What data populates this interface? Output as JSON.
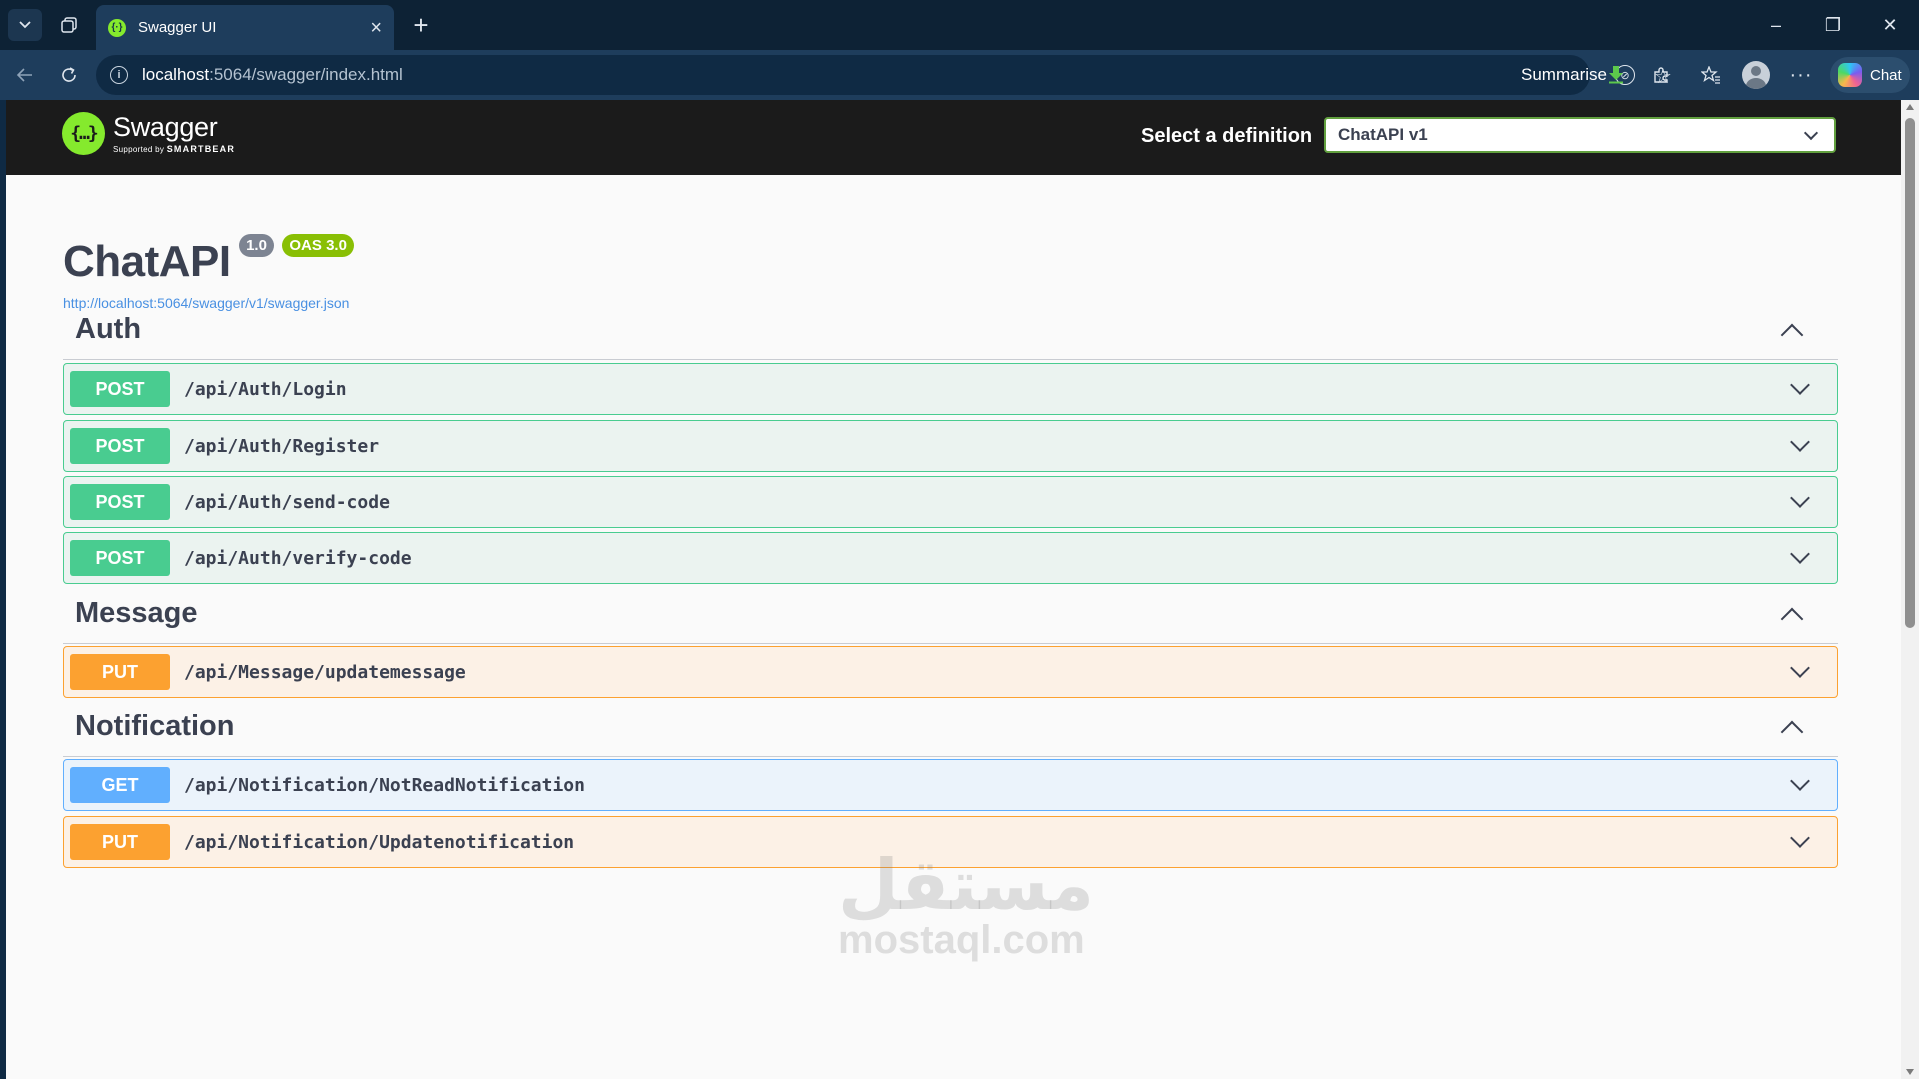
{
  "browser": {
    "tab": {
      "title": "Swagger UI",
      "favicon_glyph": "{·}"
    },
    "url": {
      "host": "localhost",
      "rest": ":5064/swagger/index.html"
    },
    "summarise_label": "Summarise",
    "chat_label": "Chat",
    "window_controls": {
      "minimize": "–",
      "restore": "❐",
      "close": "✕"
    }
  },
  "topbar": {
    "logo_name": "Swagger",
    "logo_supported": "Supported by",
    "logo_brand": "SMARTBEAR",
    "definition_label": "Select a definition",
    "definition_value": "ChatAPI v1"
  },
  "info": {
    "title": "ChatAPI",
    "version": "1.0",
    "oas": "OAS 3.0",
    "spec_url": "http://localhost:5064/swagger/v1/swagger.json"
  },
  "sections": [
    {
      "name": "Auth",
      "operations": [
        {
          "method": "POST",
          "path": "/api/Auth/Login"
        },
        {
          "method": "POST",
          "path": "/api/Auth/Register"
        },
        {
          "method": "POST",
          "path": "/api/Auth/send-code"
        },
        {
          "method": "POST",
          "path": "/api/Auth/verify-code"
        }
      ]
    },
    {
      "name": "Message",
      "operations": [
        {
          "method": "PUT",
          "path": "/api/Message/updatemessage"
        }
      ]
    },
    {
      "name": "Notification",
      "operations": [
        {
          "method": "GET",
          "path": "/api/Notification/NotReadNotification"
        },
        {
          "method": "PUT",
          "path": "/api/Notification/Updatenotification"
        }
      ]
    }
  ],
  "watermark": {
    "arabic": "مستقل",
    "latin": "mostaql.com"
  },
  "colors": {
    "post": "#49cc90",
    "put": "#fca130",
    "get": "#61affe",
    "swagger_green": "#85ea2d"
  },
  "icons": {
    "expand": "chevron-down-icon",
    "collapse": "chevron-up-icon"
  }
}
